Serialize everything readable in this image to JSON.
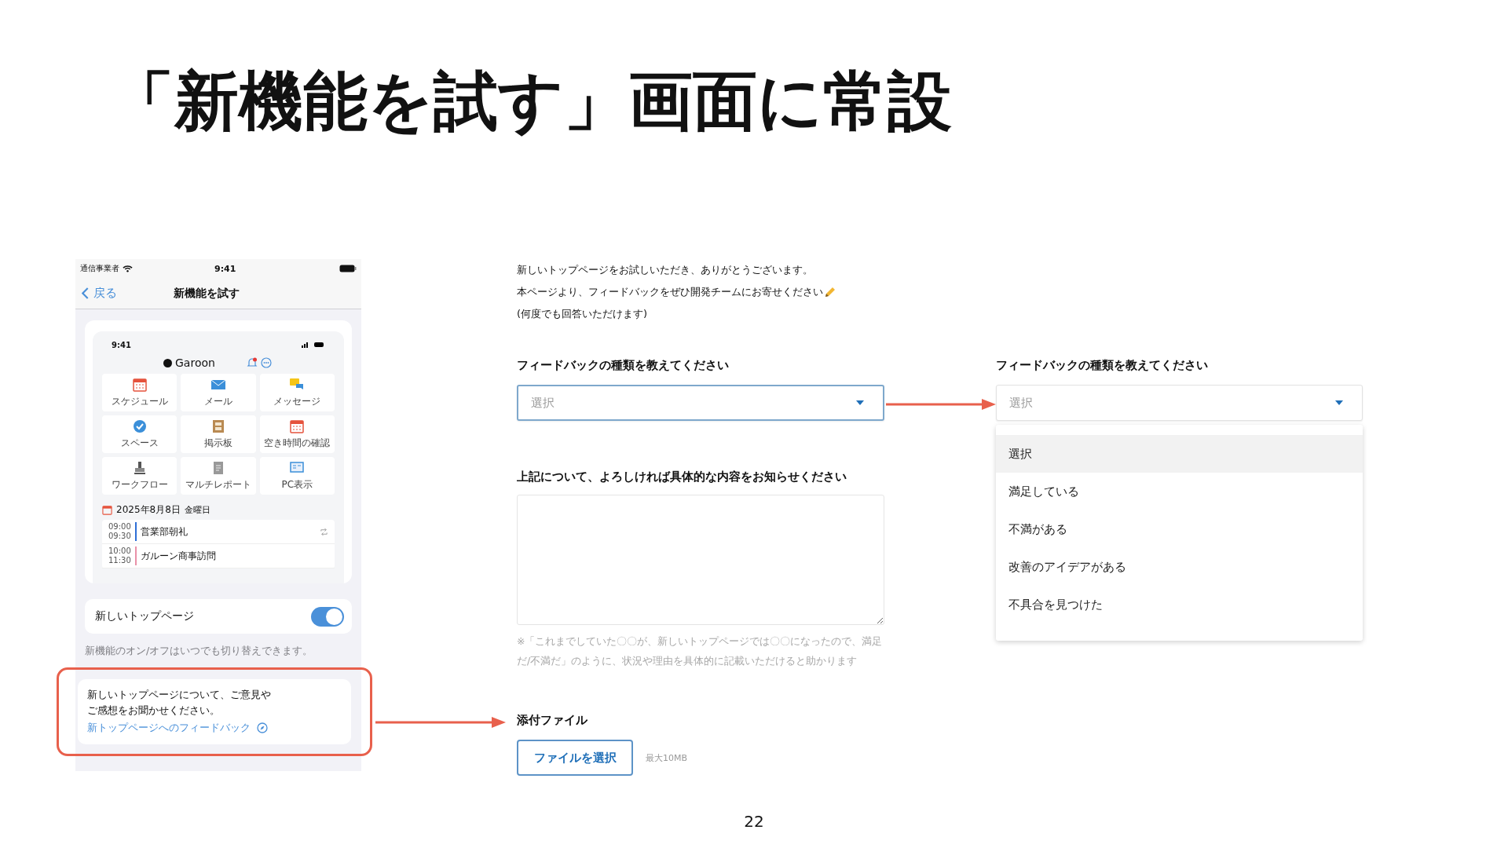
{
  "slide": {
    "title": "「新機能を試す」画面に常設",
    "page_number": "22"
  },
  "phone": {
    "status_bar": {
      "carrier": "通信事業者",
      "time": "9:41"
    },
    "nav": {
      "back": "戻る",
      "title": "新機能を試す"
    },
    "preview": {
      "time": "9:41",
      "app_name": "Garoon",
      "tiles": [
        "スケジュール",
        "メール",
        "メッセージ",
        "スペース",
        "掲示板",
        "空き時間の確認",
        "ワークフロー",
        "マルチレポート",
        "PC表示"
      ],
      "date": "2025年8月8日",
      "weekday": "金曜日",
      "events": [
        {
          "start": "09:00",
          "end": "09:30",
          "title": "営業部朝礼",
          "color": "#2f6fd6",
          "repeat": true
        },
        {
          "start": "10:00",
          "end": "11:30",
          "title": "ガルーン商事訪問",
          "color": "#e991a8",
          "repeat": false
        }
      ]
    },
    "toggle": {
      "label": "新しいトップページ",
      "on": true
    },
    "toggle_caption": "新機能のオン/オフはいつでも切り替えできます。",
    "feedback": {
      "text": "新しいトップページについて、ご意見やご感想をお聞かせください。",
      "link": "新トップページへのフィードバック",
      "highlighted": true
    }
  },
  "form": {
    "intro": [
      "新しいトップページをお試しいただき、ありがとうございます。",
      "本ページより、フィードバックをぜひ開発チームにお寄せください",
      "(何度でも回答いただけます)"
    ],
    "type_field": {
      "label": "フィードバックの種類を教えてください",
      "placeholder": "選択"
    },
    "details_field": {
      "label": "上記について、よろしければ具体的な内容をお知らせください",
      "hint": "※「これまでしていた〇〇が、新しいトップページでは〇〇になったので、満足だ/不満だ」のように、状況や理由を具体的に記載いただけると助かります"
    },
    "attachment": {
      "label": "添付ファイル",
      "button": "ファイルを選択",
      "limit": "最大10MB"
    }
  },
  "expanded_dropdown": {
    "label": "フィードバックの種類を教えてください",
    "placeholder": "選択",
    "options": [
      {
        "label": "選択",
        "selected": true
      },
      {
        "label": "満足している",
        "selected": false
      },
      {
        "label": "不満がある",
        "selected": false
      },
      {
        "label": "改善のアイデアがある",
        "selected": false
      },
      {
        "label": "不具合を見つけた",
        "selected": false
      }
    ]
  }
}
